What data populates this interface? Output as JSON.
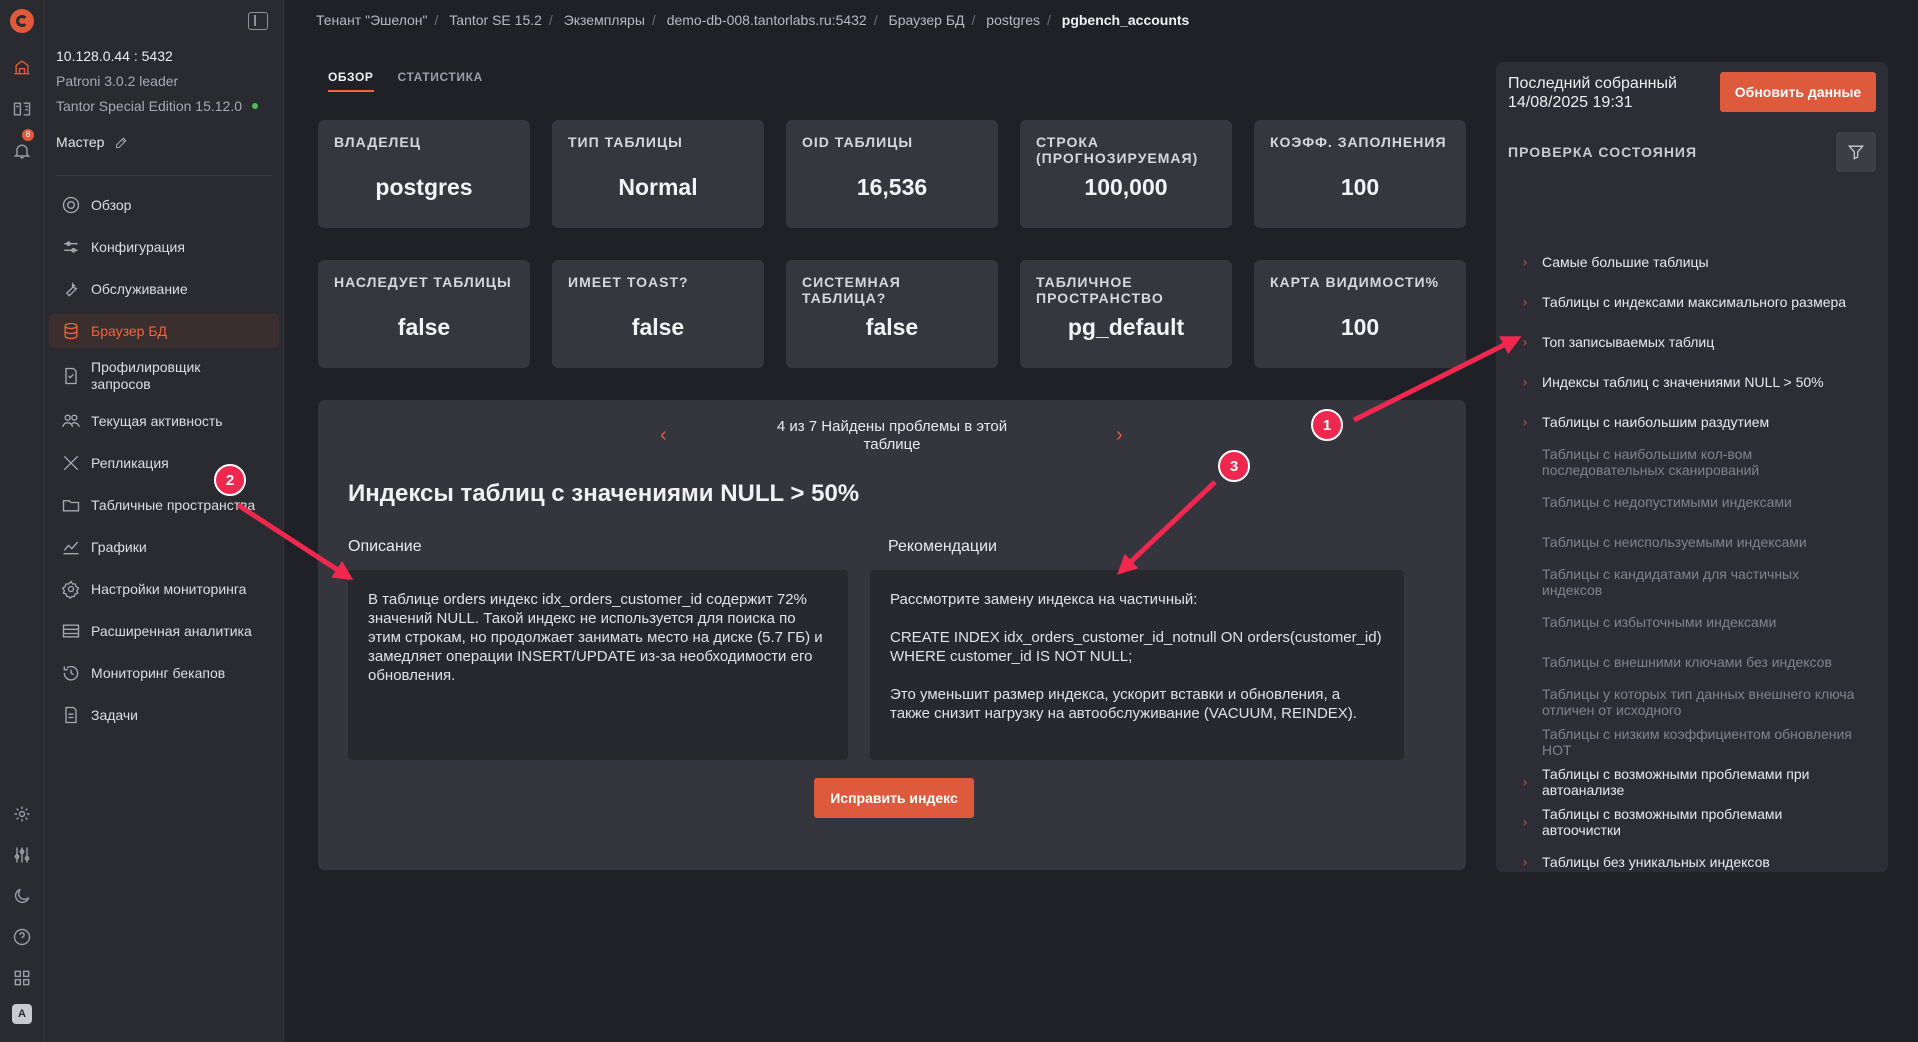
{
  "server": {
    "address": "10.128.0.44 : 5432",
    "patroni": "Patroni 3.0.2 leader",
    "edition": "Tantor Special Edition 15.12.0",
    "role": "Мастер"
  },
  "notifications_count": "8",
  "avatar_letter": "A",
  "sidebar": {
    "items": [
      {
        "label": "Обзор",
        "icon": "overview-icon"
      },
      {
        "label": "Конфигурация",
        "icon": "sliders-icon"
      },
      {
        "label": "Обслуживание",
        "icon": "wrench-icon"
      },
      {
        "label": "Браузер БД",
        "icon": "database-icon",
        "active": true
      },
      {
        "label": "Профилировщик\nзапросов",
        "icon": "profiler-icon"
      },
      {
        "label": "Текущая активность",
        "icon": "users-icon"
      },
      {
        "label": "Репликация",
        "icon": "replication-icon"
      },
      {
        "label": "Табличные пространства",
        "icon": "folder-icon"
      },
      {
        "label": "Графики",
        "icon": "chart-icon"
      },
      {
        "label": "Настройки мониторинга",
        "icon": "gear-icon"
      },
      {
        "label": "Расширенная аналитика",
        "icon": "table-icon"
      },
      {
        "label": "Мониторинг бекапов",
        "icon": "history-icon"
      },
      {
        "label": "Задачи",
        "icon": "document-icon"
      }
    ]
  },
  "breadcrumb": [
    "Тенант \"Эшелон\"",
    "Tantor SE 15.2",
    "Экземпляры",
    "demo-db-008.tantorlabs.ru:5432",
    "Браузер БД",
    "postgres",
    "pgbench_accounts"
  ],
  "tabs": [
    "ОБЗОР",
    "СТАТИСТИКА"
  ],
  "cards": [
    {
      "label": "ВЛАДЕЛЕЦ",
      "value": "postgres"
    },
    {
      "label": "ТИП ТАБЛИЦЫ",
      "value": "Normal"
    },
    {
      "label": "OID ТАБЛИЦЫ",
      "value": "16,536"
    },
    {
      "label": "СТРОКА\n(ПРОГНОЗИРУЕМАЯ)",
      "value": "100,000"
    },
    {
      "label": "КОЭФФ. ЗАПОЛНЕНИЯ",
      "value": "100"
    },
    {
      "label": "НАСЛЕДУЕТ ТАБЛИЦЫ",
      "value": "false"
    },
    {
      "label": "ИМЕЕТ TOAST?",
      "value": "false"
    },
    {
      "label": "СИСТЕМНАЯ\nТАБЛИЦА?",
      "value": "false"
    },
    {
      "label": "ТАБЛИЧНОЕ\nПРОСТРАНСТВО",
      "value": "pg_default"
    },
    {
      "label": "КАРТА ВИДИМОСТИ%",
      "value": "100"
    }
  ],
  "issue": {
    "pager": "4 из 7 Найдены проблемы в этой таблице",
    "title": "Индексы таблиц с значениями NULL > 50%",
    "desc_header": "Описание",
    "rec_header": "Рекомендации",
    "description": "В таблице orders индекс idx_orders_customer_id содержит 72% значений NULL. Такой индекс не используется для поиска по этим строкам, но продолжает занимать место на диске (5.7 ГБ) и замедляет операции INSERT/UPDATE из-за необходимости его обновления.",
    "recommendation": "Рассмотрите замену индекса на частичный:\n\nCREATE INDEX idx_orders_customer_id_notnull ON orders(customer_id) WHERE customer_id IS NOT NULL;\n\nЭто уменьшит размер индекса, ускорит вставки и обновления, а также снизит нагрузку на автообслуживание (VACUUM, REINDEX).",
    "fix_button": "Исправить индекс"
  },
  "right": {
    "last_collected": "Последний собранный\n14/08/2025 19:31",
    "refresh_button": "Обновить данные",
    "health_header": "ПРОВЕРКА СОСТОЯНИЯ",
    "checks": [
      {
        "label": "Самые большие таблицы",
        "flag": true
      },
      {
        "label": "Таблицы с индексами максимального размера",
        "flag": true
      },
      {
        "label": "Топ записываемых таблиц",
        "flag": true
      },
      {
        "label": "Индексы таблиц с значениями NULL > 50%",
        "flag": true
      },
      {
        "label": "Таблицы с наибольшим раздутием",
        "flag": true
      },
      {
        "label": "Таблицы с наибольшим кол-вом\nпоследовательных сканирований",
        "flag": false
      },
      {
        "label": "Таблицы с недопустимыми индексами",
        "flag": false
      },
      {
        "label": "Таблицы с неиспользуемыми индексами",
        "flag": false
      },
      {
        "label": "Таблицы с кандидатами для частичных\nиндексов",
        "flag": false
      },
      {
        "label": "Таблицы с избыточными индексами",
        "flag": false
      },
      {
        "label": "Таблицы с внешними ключами без индексов",
        "flag": false
      },
      {
        "label": "Таблицы у которых тип данных внешнего ключа\nотличен от исходного",
        "flag": false
      },
      {
        "label": "Таблицы с низким коэффициентом обновления\nHOT",
        "flag": false
      },
      {
        "label": "Таблицы с возможными проблемами при\nавтоанализе",
        "flag": true
      },
      {
        "label": "Таблицы с возможными проблемами\nавтоочистки",
        "flag": true
      },
      {
        "label": "Таблицы без уникальных индексов",
        "flag": true
      }
    ]
  },
  "annotations": [
    "1",
    "2",
    "3"
  ],
  "colors": {
    "accent": "#dd5a3c",
    "annotation": "#f0284f"
  }
}
